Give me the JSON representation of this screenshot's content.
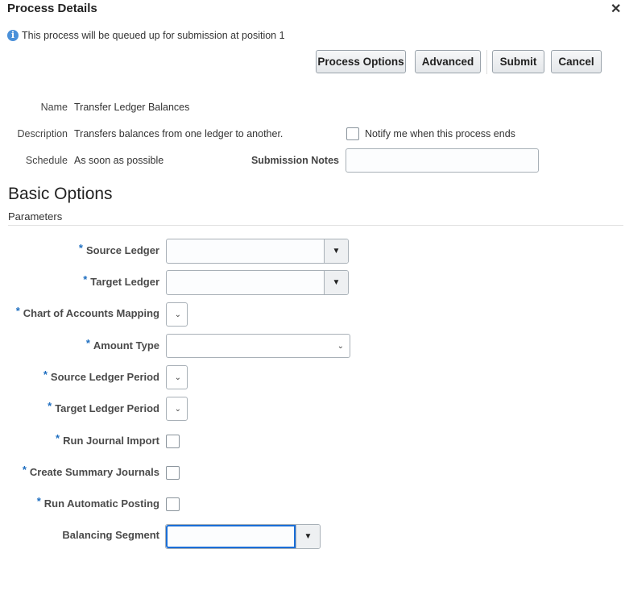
{
  "dialog": {
    "title": "Process Details",
    "close_icon": "close-icon",
    "info_message": "This process will be queued up for submission at position 1"
  },
  "buttons": {
    "process_options": "Process Options",
    "advanced": "Advanced",
    "submit": "Submit",
    "cancel": "Cancel"
  },
  "details": {
    "name_label": "Name",
    "name_value": "Transfer Ledger Balances",
    "description_label": "Description",
    "description_value": "Transfers balances from one ledger to another.",
    "schedule_label": "Schedule",
    "schedule_value": "As soon as possible",
    "notify_label": "Notify me when this process ends",
    "notify_checked": false,
    "submission_notes_label": "Submission Notes",
    "submission_notes_value": ""
  },
  "basic_options": {
    "heading": "Basic Options",
    "parameters_label": "Parameters",
    "required_marker": "*",
    "fields": {
      "source_ledger": "Source Ledger",
      "target_ledger": "Target Ledger",
      "coa_mapping": "Chart of Accounts Mapping",
      "amount_type": "Amount Type",
      "source_period": "Source Ledger Period",
      "target_period": "Target Ledger Period",
      "run_journal_import": "Run Journal Import",
      "create_summary": "Create Summary Journals",
      "run_posting": "Run Automatic Posting",
      "balancing_segment": "Balancing Segment"
    }
  }
}
